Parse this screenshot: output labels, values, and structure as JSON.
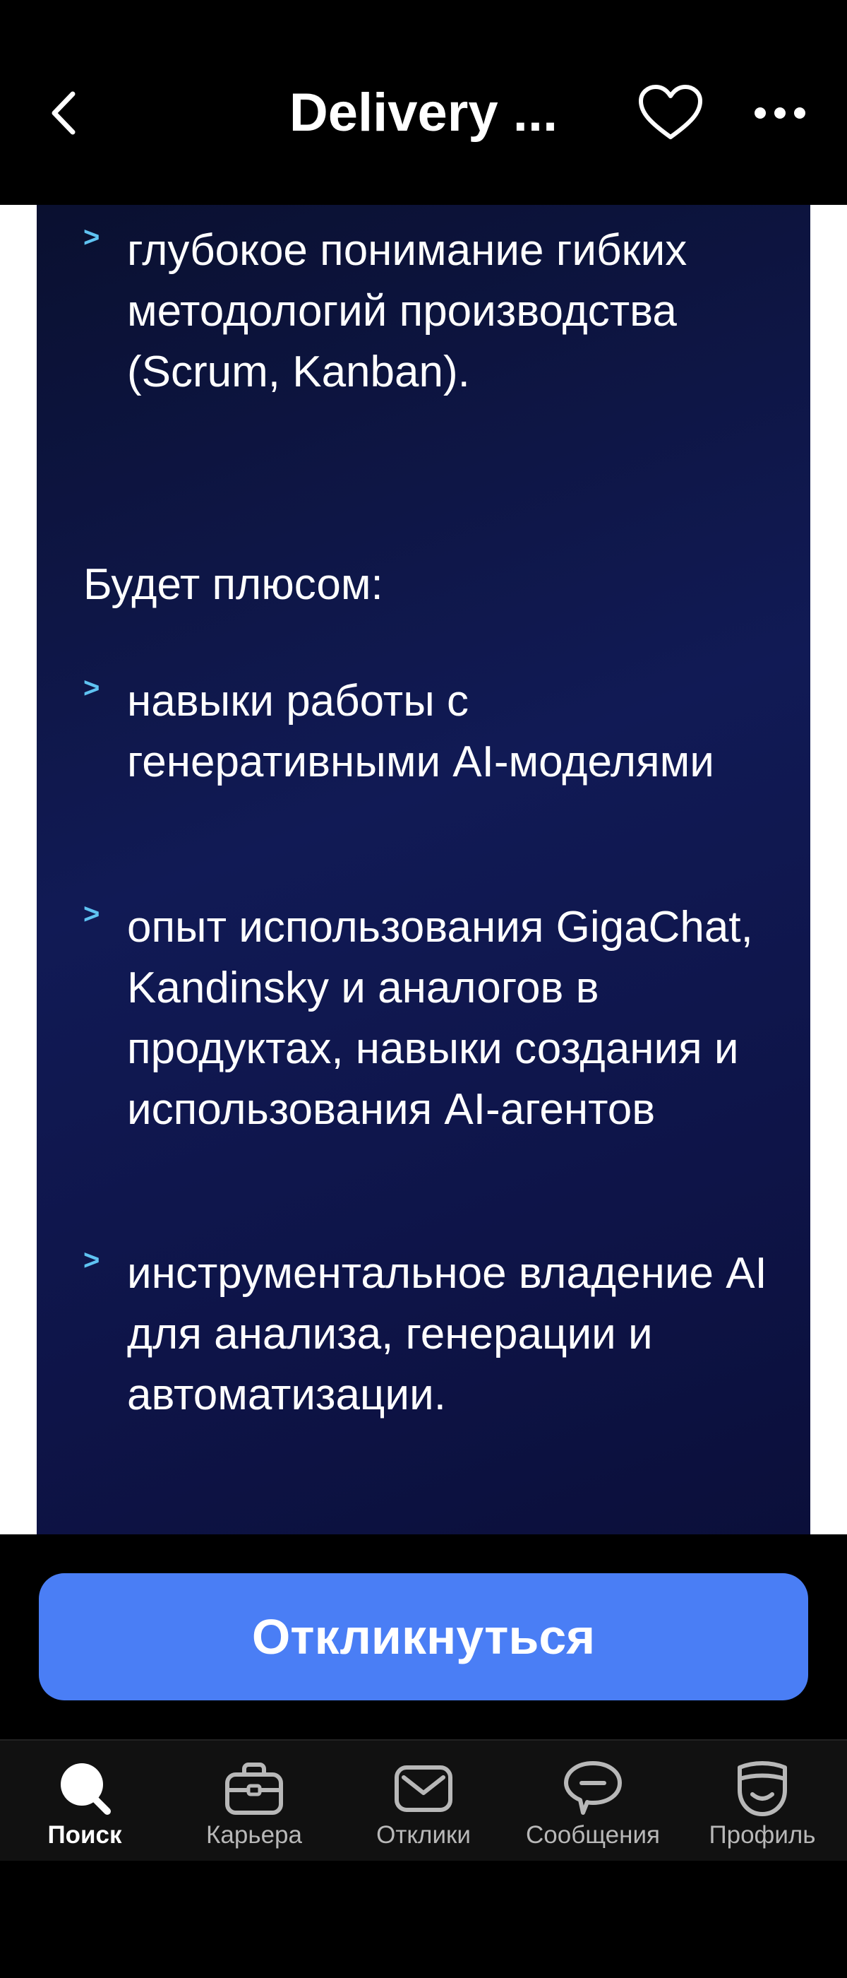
{
  "header": {
    "title": "Delivery ...",
    "back_icon": "chevron-left-icon",
    "favorite_icon": "heart-icon",
    "more_icon": "more-dots-icon"
  },
  "content": {
    "requirements_bullets": [
      "глубокое понимание гибких методологий производства (Scrum, Kanban)."
    ],
    "plus_heading": "Будет плюсом:",
    "plus_bullets": [
      "навыки работы с генеративными AI-моделями",
      "опыт использования GigaChat, Kandinsky и аналогов в продуктах, навыки создания и использования AI-агентов",
      "инструментальное владение AI для анализа, генерации и автоматизации."
    ],
    "bullet_marker": ">"
  },
  "cta": {
    "label": "Откликнуться"
  },
  "bottom_nav": {
    "items": [
      {
        "label": "Поиск",
        "icon": "search-icon",
        "active": true
      },
      {
        "label": "Карьера",
        "icon": "briefcase-icon",
        "active": false
      },
      {
        "label": "Отклики",
        "icon": "envelope-icon",
        "active": false
      },
      {
        "label": "Сообщения",
        "icon": "chat-bubble-icon",
        "active": false
      },
      {
        "label": "Профиль",
        "icon": "profile-icon",
        "active": false
      }
    ]
  },
  "colors": {
    "background": "#000000",
    "card_gradient_start": "#0a1030",
    "card_gradient_mid": "#111a55",
    "bullet_accent": "#5fc3f2",
    "cta_blue": "#4a7ef5",
    "nav_background": "#111111",
    "nav_label_inactive": "#b8b8b8"
  }
}
